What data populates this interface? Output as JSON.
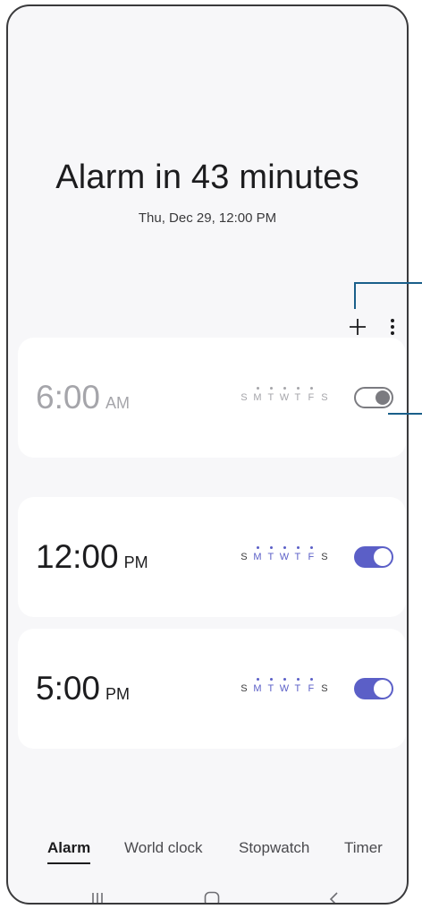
{
  "header": {
    "title": "Alarm in 43 minutes",
    "subtitle": "Thu, Dec 29, 12:00 PM"
  },
  "toolbar": {
    "add_icon": "plus-icon",
    "more_icon": "more-vertical-icon"
  },
  "alarms": [
    {
      "time": "6:00",
      "ampm": "AM",
      "enabled": false,
      "days": [
        {
          "letter": "S",
          "selected": false
        },
        {
          "letter": "M",
          "selected": true
        },
        {
          "letter": "T",
          "selected": true
        },
        {
          "letter": "W",
          "selected": true
        },
        {
          "letter": "T",
          "selected": true
        },
        {
          "letter": "F",
          "selected": true
        },
        {
          "letter": "S",
          "selected": false
        }
      ]
    },
    {
      "time": "12:00",
      "ampm": "PM",
      "enabled": true,
      "days": [
        {
          "letter": "S",
          "selected": false
        },
        {
          "letter": "M",
          "selected": true
        },
        {
          "letter": "T",
          "selected": true
        },
        {
          "letter": "W",
          "selected": true
        },
        {
          "letter": "T",
          "selected": true
        },
        {
          "letter": "F",
          "selected": true
        },
        {
          "letter": "S",
          "selected": false
        }
      ]
    },
    {
      "time": "5:00",
      "ampm": "PM",
      "enabled": true,
      "days": [
        {
          "letter": "S",
          "selected": false
        },
        {
          "letter": "M",
          "selected": true
        },
        {
          "letter": "T",
          "selected": true
        },
        {
          "letter": "W",
          "selected": true
        },
        {
          "letter": "T",
          "selected": true
        },
        {
          "letter": "F",
          "selected": true
        },
        {
          "letter": "S",
          "selected": false
        }
      ]
    }
  ],
  "tabs": [
    {
      "label": "Alarm",
      "active": true
    },
    {
      "label": "World clock",
      "active": false
    },
    {
      "label": "Stopwatch",
      "active": false
    },
    {
      "label": "Timer",
      "active": false
    }
  ],
  "navbar": {
    "recents_icon": "recents-icon",
    "home_icon": "home-icon",
    "back_icon": "back-icon"
  },
  "colors": {
    "accent": "#5b5fc7",
    "background": "#f7f7f9",
    "card": "#ffffff",
    "text": "#1c1c1e",
    "disabled_text": "#a5a5aa",
    "callout_line": "#1a5f8a"
  }
}
